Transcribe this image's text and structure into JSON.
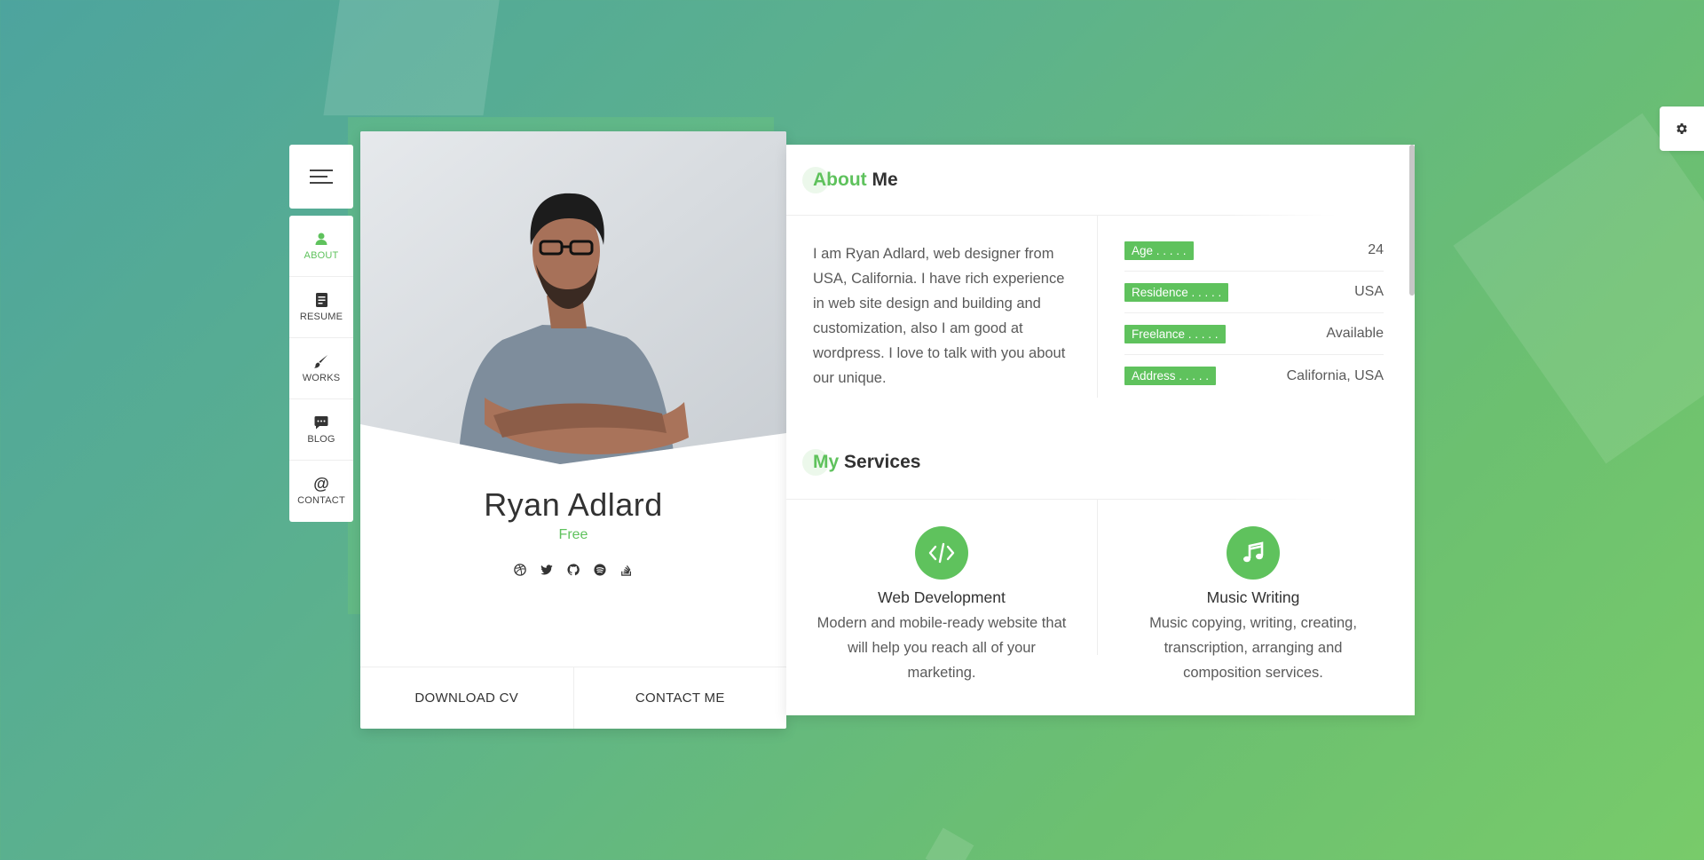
{
  "settings": {
    "icon": "gear-icon"
  },
  "menu": {
    "icon": "hamburger-icon"
  },
  "nav": {
    "items": [
      {
        "label": "ABOUT",
        "icon": "person-icon",
        "active": true
      },
      {
        "label": "RESUME",
        "icon": "document-icon",
        "active": false
      },
      {
        "label": "WORKS",
        "icon": "brush-icon",
        "active": false
      },
      {
        "label": "BLOG",
        "icon": "chat-icon",
        "active": false
      },
      {
        "label": "CONTACT",
        "icon": "at-icon",
        "active": false
      }
    ]
  },
  "profile": {
    "name": "Ryan Adlard",
    "role": "Free",
    "social": [
      "dribbble-icon",
      "twitter-icon",
      "github-icon",
      "spotify-icon",
      "stackoverflow-icon"
    ],
    "download_cv": "DOWNLOAD CV",
    "contact_me": "CONTACT ME"
  },
  "about": {
    "title_hl": "About",
    "title_rest": " Me",
    "text": "I am Ryan Adlard, web designer from USA, California. I have rich experience in web site design and building and customization, also I am good at wordpress. I love to talk with you about our unique.",
    "info": [
      {
        "label": "Age . . . . .",
        "value": "24"
      },
      {
        "label": "Residence . . . . .",
        "value": "USA"
      },
      {
        "label": "Freelance . . . . .",
        "value": "Available"
      },
      {
        "label": "Address . . . . .",
        "value": "California, USA"
      }
    ]
  },
  "services": {
    "title_hl": "My",
    "title_rest": " Services",
    "items": [
      {
        "icon": "code-icon",
        "title": "Web Development",
        "desc": "Modern and mobile-ready website that will help you reach all of your marketing."
      },
      {
        "icon": "music-note-icon",
        "title": "Music Writing",
        "desc": "Music copying, writing, creating, transcription, arranging and composition services."
      }
    ]
  },
  "colors": {
    "accent": "#5fc25d",
    "text": "#323232"
  }
}
